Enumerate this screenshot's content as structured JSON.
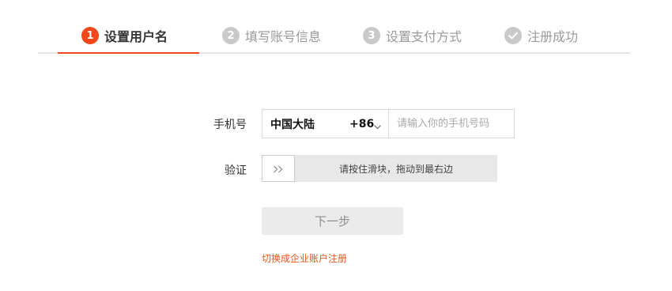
{
  "steps": [
    {
      "number": "1",
      "label": "设置用户名",
      "state": "active"
    },
    {
      "number": "2",
      "label": "填写账号信息",
      "state": "pending"
    },
    {
      "number": "3",
      "label": "设置支付方式",
      "state": "pending"
    },
    {
      "number": "",
      "icon": "checkmark-icon",
      "label": "注册成功",
      "state": "pending"
    }
  ],
  "form": {
    "phone_label": "手机号",
    "region": "中国大陆",
    "country_code": "+86",
    "phone_placeholder": "请输入你的手机号码",
    "phone_value": "",
    "verify_label": "验证",
    "slider_handle_icon": "double-chevron-right-icon",
    "slider_text": "请按住滑块，拖动到最右边",
    "next_label": "下一步",
    "enterprise_link": "切换成企业账户注册"
  },
  "colors": {
    "accent": "#f3461c",
    "link": "#e4561d",
    "inactive_step": "#c9c9c9",
    "disabled_button": "#ebebeb"
  }
}
